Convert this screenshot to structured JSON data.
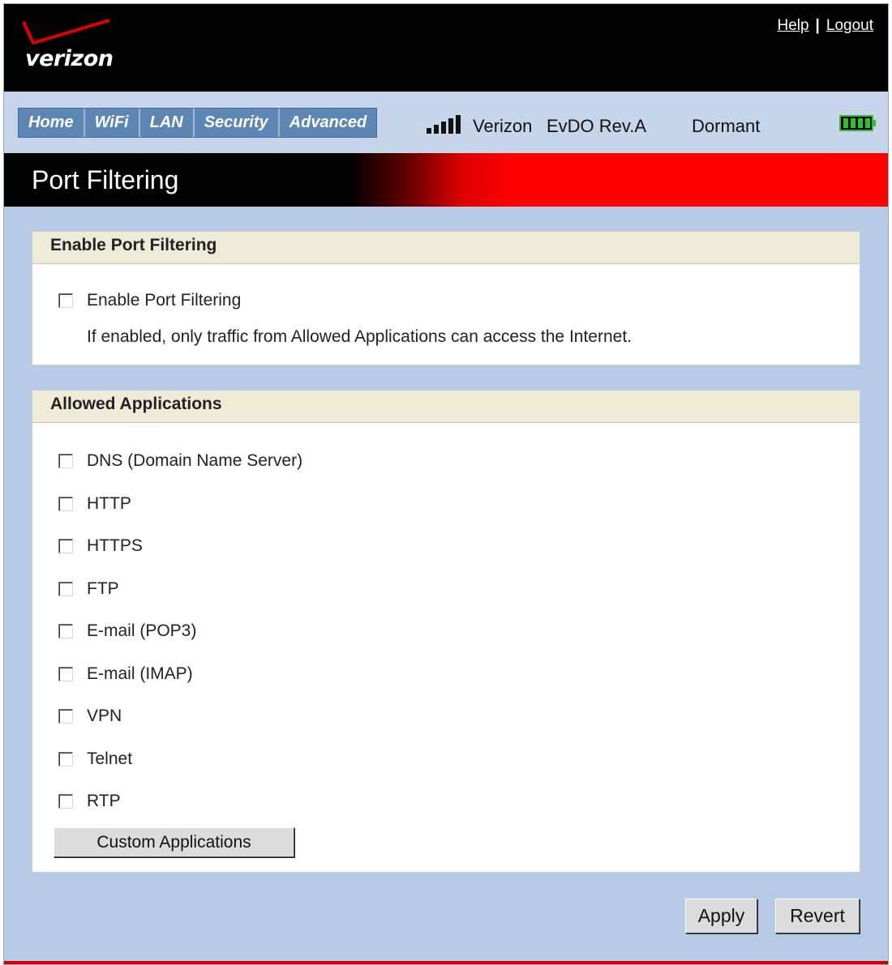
{
  "header": {
    "logo_text": "verizon",
    "help_link": "Help",
    "separator": "|",
    "logout_link": "Logout"
  },
  "nav": {
    "tabs": [
      {
        "label": "Home"
      },
      {
        "label": "WiFi"
      },
      {
        "label": "LAN"
      },
      {
        "label": "Security"
      },
      {
        "label": "Advanced"
      }
    ],
    "signal_bars": 5,
    "network_name": "Verizon",
    "network_type": "EvDO Rev.A",
    "connection_status": "Dormant",
    "battery_icon": "battery-full-icon",
    "battery_color": "#2fbf2f"
  },
  "page": {
    "title": "Port Filtering"
  },
  "enable_section": {
    "heading": "Enable Port Filtering",
    "checkbox_label": "Enable Port Filtering",
    "checked": false,
    "note": "If enabled, only traffic from Allowed Applications can access the Internet."
  },
  "allowed_section": {
    "heading": "Allowed Applications",
    "applications": [
      {
        "label": "DNS (Domain Name Server)",
        "checked": false
      },
      {
        "label": "HTTP",
        "checked": false
      },
      {
        "label": "HTTPS",
        "checked": false
      },
      {
        "label": "FTP",
        "checked": false
      },
      {
        "label": "E-mail (POP3)",
        "checked": false
      },
      {
        "label": "E-mail (IMAP)",
        "checked": false
      },
      {
        "label": "VPN",
        "checked": false
      },
      {
        "label": "Telnet",
        "checked": false
      },
      {
        "label": "RTP",
        "checked": false
      }
    ],
    "custom_button": "Custom Applications"
  },
  "actions": {
    "apply": "Apply",
    "revert": "Revert"
  },
  "colors": {
    "brand_red": "#ff0000",
    "nav_tab_blue": "#5d86b5",
    "page_background": "#b7cbe6",
    "panel_header": "#efebd9"
  }
}
